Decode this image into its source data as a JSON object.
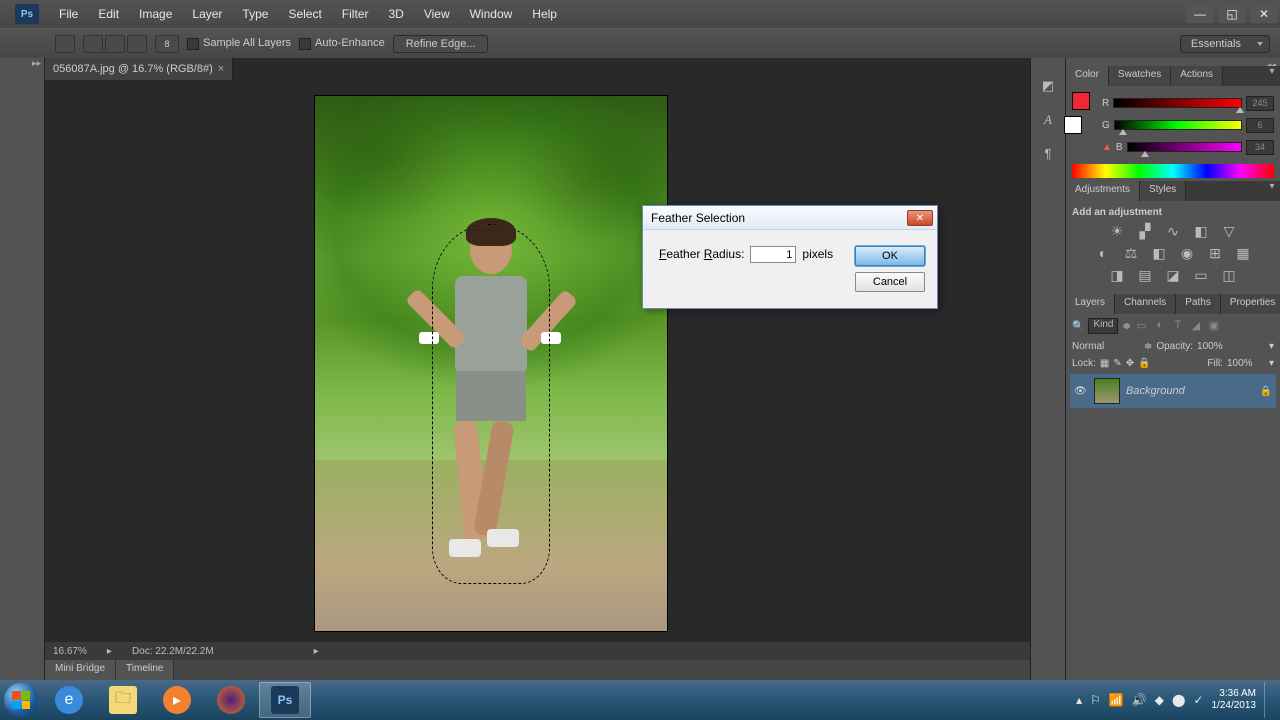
{
  "menubar": [
    "File",
    "Edit",
    "Image",
    "Layer",
    "Type",
    "Select",
    "Filter",
    "3D",
    "View",
    "Window",
    "Help"
  ],
  "optbar": {
    "size_label": "8",
    "sample_all": "Sample All Layers",
    "auto_enhance": "Auto-Enhance",
    "refine": "Refine Edge...",
    "workspace": "Essentials"
  },
  "doctab": "056087A.jpg @ 16.7% (RGB/8#)",
  "status": {
    "zoom": "16.67%",
    "doc": "Doc: 22.2M/22.2M"
  },
  "bottomtabs": [
    "Mini Bridge",
    "Timeline"
  ],
  "colorpanel": {
    "tabs": [
      "Color",
      "Swatches",
      "Actions"
    ],
    "channels": [
      {
        "label": "R",
        "value": "245",
        "pos": 96
      },
      {
        "label": "G",
        "value": "6",
        "pos": 3
      },
      {
        "label": "B",
        "value": "34",
        "pos": 12
      }
    ]
  },
  "adjustments": {
    "tabs": [
      "Adjustments",
      "Styles"
    ],
    "heading": "Add an adjustment"
  },
  "layerspanel": {
    "tabs": [
      "Layers",
      "Channels",
      "Paths",
      "Properties"
    ],
    "kind": "Kind",
    "blend": "Normal",
    "opacity_label": "Opacity:",
    "opacity": "100%",
    "lock_label": "Lock:",
    "fill_label": "Fill:",
    "fill": "100%",
    "layer_name": "Background"
  },
  "dialog": {
    "title": "Feather Selection",
    "label": "Feather Radius:",
    "value": "1",
    "units": "pixels",
    "ok": "OK",
    "cancel": "Cancel"
  },
  "taskbar": {
    "time": "3:36 AM",
    "date": "1/24/2013"
  }
}
